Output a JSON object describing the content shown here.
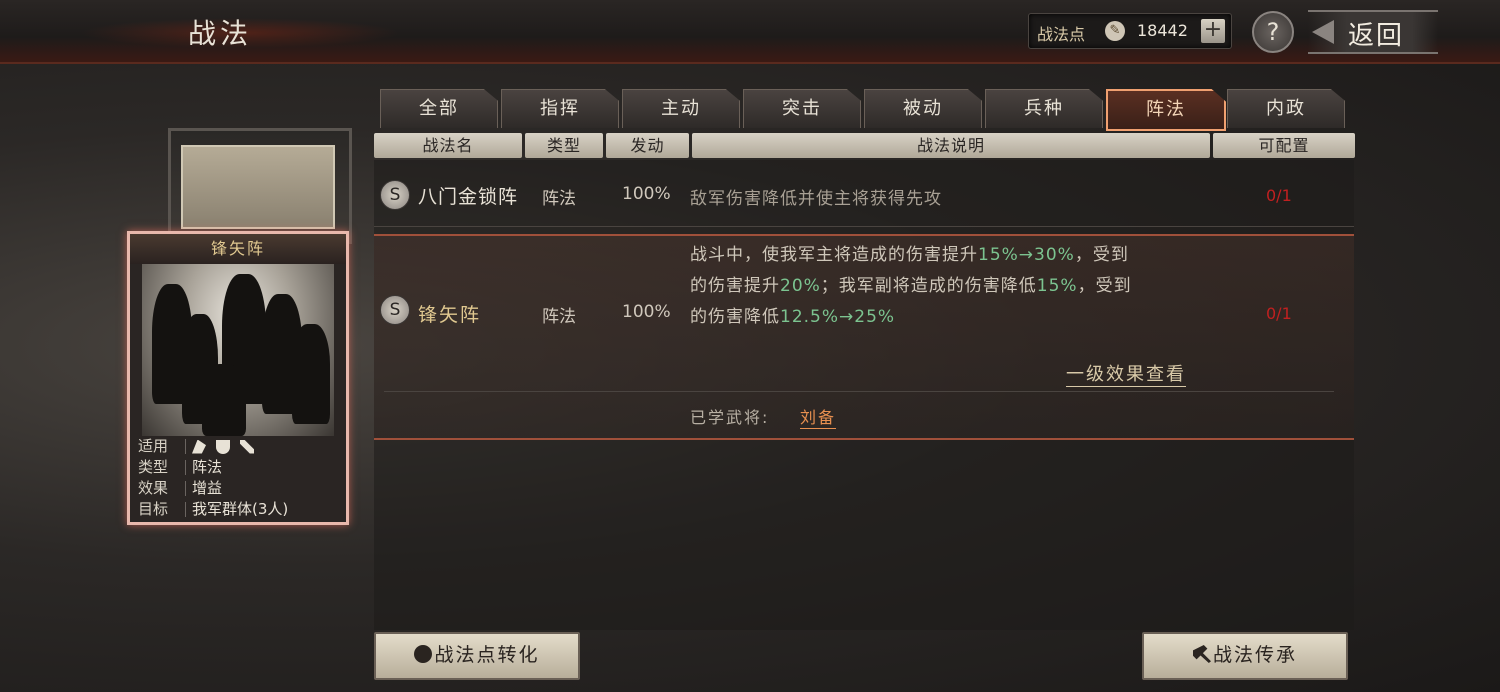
{
  "header": {
    "title": "战法",
    "points_label": "战法点",
    "points_value": "18442",
    "plus": "+",
    "help": "?",
    "back": "返回"
  },
  "card": {
    "name": "锋矢阵",
    "rows": [
      {
        "key": "适用",
        "value": ""
      },
      {
        "key": "类型",
        "value": "阵法"
      },
      {
        "key": "效果",
        "value": "增益"
      },
      {
        "key": "目标",
        "value": "我军群体(3人)"
      }
    ],
    "applicable_icons": [
      "cavalry-icon",
      "shield-icon",
      "archer-icon"
    ]
  },
  "tabs": [
    "全部",
    "指挥",
    "主动",
    "突击",
    "被动",
    "兵种",
    "阵法",
    "内政"
  ],
  "active_tab": "阵法",
  "columns": [
    "战法名",
    "类型",
    "发动",
    "战法说明",
    "可配置"
  ],
  "rows": [
    {
      "grade": "S",
      "name": "八门金锁阵",
      "type": "阵法",
      "rate": "100%",
      "desc": "敌军伤害降低并使主将获得先攻",
      "config": "0/1"
    },
    {
      "grade": "S",
      "name": "锋矢阵",
      "type": "阵法",
      "rate": "100%",
      "desc": {
        "p1": "战斗中，使我军主将造成的伤害提升",
        "g1": "15%→30%",
        "p2": "，受到",
        "p3": "的伤害提升",
        "g2": "20%",
        "p4": "；我军副将造成的伤害降低",
        "g3": "15%",
        "p5": "，受到",
        "p6": "的伤害降低",
        "g4": "12.5%→25%"
      },
      "config": "0/1",
      "effect_link": "一级效果查看",
      "learned_label": "已学武将:",
      "learned_general": "刘备"
    }
  ],
  "buttons": {
    "convert": "战法点转化",
    "inherit": "战法传承"
  },
  "colors": {
    "highlight_green": "#7cc490",
    "config_red": "#c02020",
    "active_tab_border": "#f0a070"
  }
}
